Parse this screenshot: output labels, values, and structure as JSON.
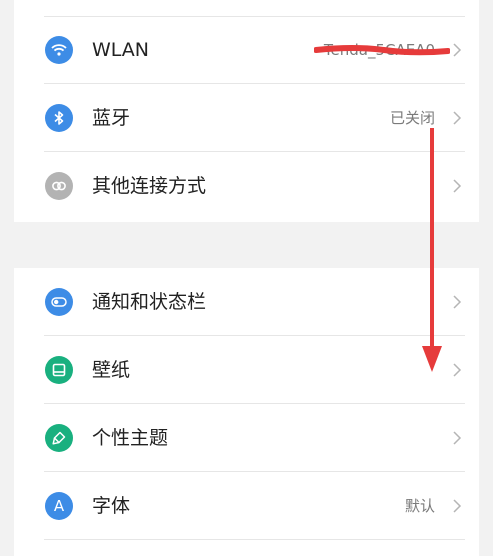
{
  "settings": {
    "group1": [
      {
        "label": "WLAN",
        "value": "Tenda_5CAEA0",
        "icon": "wifi-icon",
        "color": "#3d8ce6"
      },
      {
        "label": "蓝牙",
        "value": "已关闭",
        "icon": "bluetooth-icon",
        "color": "#3d8ce6"
      },
      {
        "label": "其他连接方式",
        "value": "",
        "icon": "link-icon",
        "color": "#b3b3b3"
      }
    ],
    "group2": [
      {
        "label": "通知和状态栏",
        "value": "",
        "icon": "toggle-icon",
        "color": "#3d8ce6"
      },
      {
        "label": "壁纸",
        "value": "",
        "icon": "wallpaper-icon",
        "color": "#19b07f"
      },
      {
        "label": "个性主题",
        "value": "",
        "icon": "brush-icon",
        "color": "#19b07f"
      },
      {
        "label": "字体",
        "value": "默认",
        "icon": "font-icon",
        "color": "#3d8ce6",
        "glyph": "A"
      }
    ]
  },
  "annotation_color": "#e63b3b"
}
